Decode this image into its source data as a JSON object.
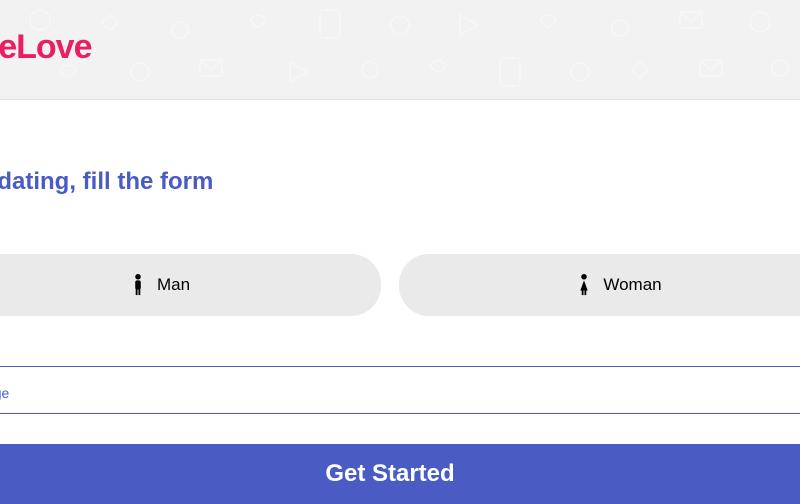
{
  "brand": "ateLove",
  "title": "art dating, fill the form",
  "gender": {
    "man": "Man",
    "woman": "Woman"
  },
  "age_field_label": ":",
  "age_placeholder": "ct your age",
  "cta_label": "Get Started"
}
